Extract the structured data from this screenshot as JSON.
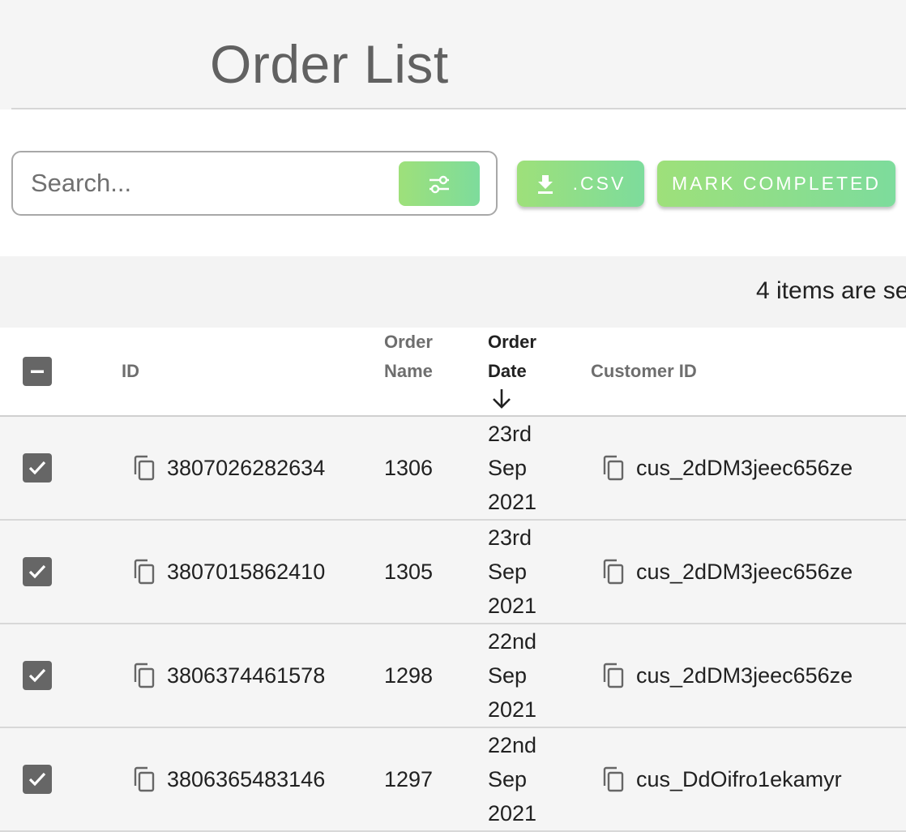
{
  "page": {
    "title": "Order List"
  },
  "toolbar": {
    "search_placeholder": "Search...",
    "filter_icon": "sliders-icon",
    "csv_label": ".CSV",
    "csv_icon": "download-icon",
    "mark_completed_label": "MARK COMPLETED",
    "accent_gradient": [
      "#9ee07a",
      "#7ddc9c"
    ]
  },
  "selection": {
    "text": "4 items are se"
  },
  "table": {
    "columns": {
      "select": "",
      "id": "ID",
      "order_name_line1": "Order",
      "order_name_line2": "Name",
      "order_date_line1": "Order",
      "order_date_line2": "Date",
      "customer_id": "Customer ID"
    },
    "sort": {
      "column": "Order Date",
      "direction": "descending",
      "icon": "arrow-down-icon"
    },
    "rows": [
      {
        "selected": true,
        "id": "3807026282634",
        "order_name": "1306",
        "date_day": "23rd",
        "date_month": "Sep",
        "date_year": "2021",
        "customer_id": "cus_2dDM3jeec656ze"
      },
      {
        "selected": true,
        "id": "3807015862410",
        "order_name": "1305",
        "date_day": "23rd",
        "date_month": "Sep",
        "date_year": "2021",
        "customer_id": "cus_2dDM3jeec656ze"
      },
      {
        "selected": true,
        "id": "3806374461578",
        "order_name": "1298",
        "date_day": "22nd",
        "date_month": "Sep",
        "date_year": "2021",
        "customer_id": "cus_2dDM3jeec656ze"
      },
      {
        "selected": true,
        "id": "3806365483146",
        "order_name": "1297",
        "date_day": "22nd",
        "date_month": "Sep",
        "date_year": "2021",
        "customer_id": "cus_DdOifro1ekamyr"
      }
    ]
  }
}
